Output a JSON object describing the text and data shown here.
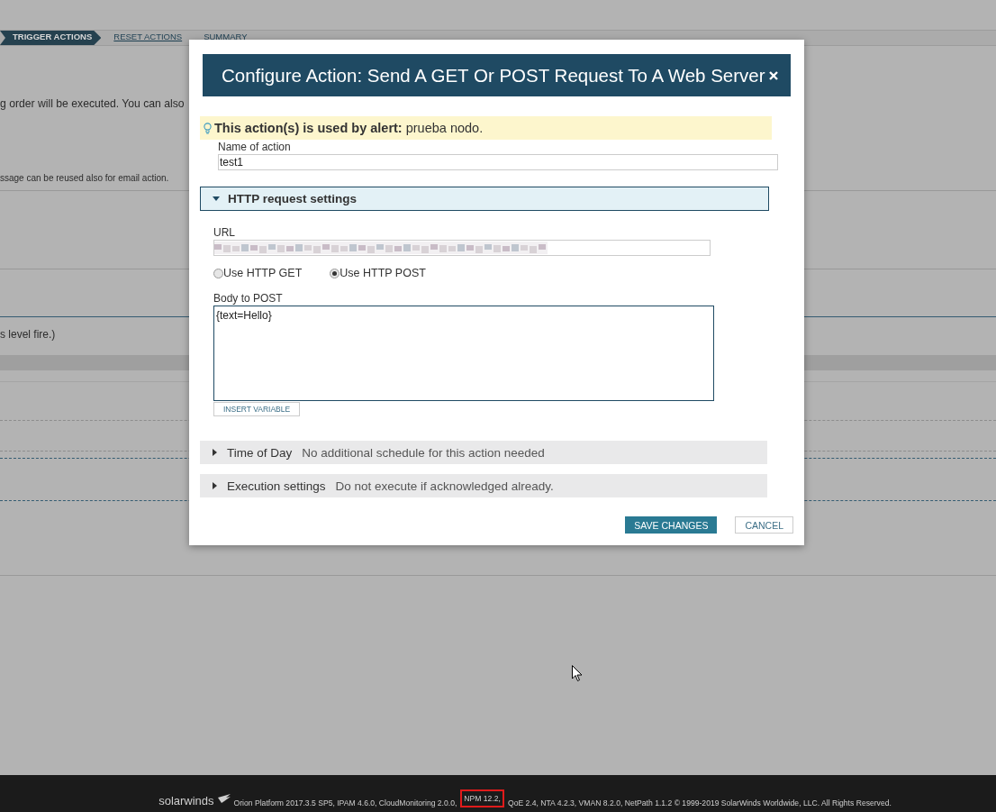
{
  "wizard_steps": [
    {
      "label": "TRIGGER ACTIONS",
      "selected": true
    },
    {
      "label": "RESET ACTIONS",
      "selected": false
    },
    {
      "label": "SUMMARY",
      "selected": false
    }
  ],
  "background_texts": [
    "g order will be executed. You can also",
    "ssage can be reused also for email action.",
    "s level fire.)"
  ],
  "dialog": {
    "title": "Configure Action: Send A GET Or POST Request To A Web Server",
    "notice": {
      "label": "This action(s) is used by alert:",
      "value": "prueba nodo."
    },
    "name_field": {
      "label": "Name of action",
      "value": "test1"
    },
    "http_section": {
      "title": "HTTP request settings",
      "expanded": true,
      "url_label": "URL",
      "methods": [
        {
          "label": "Use HTTP GET",
          "selected": false
        },
        {
          "label": "Use HTTP POST",
          "selected": true
        }
      ],
      "body_label": "Body to POST",
      "body_value": "{text=Hello}",
      "insert_button": "INSERT VARIABLE"
    },
    "collapsed_sections": [
      {
        "title": "Time of Day",
        "summary": "No additional schedule for this action needed",
        "expanded": false
      },
      {
        "title": "Execution settings",
        "summary": "Do not execute if acknowledged already.",
        "expanded": false
      }
    ],
    "save_button": "SAVE CHANGES",
    "cancel_button": "CANCEL"
  },
  "footer": {
    "brand": "solarwinds",
    "versions_before": "Orion Platform 2017.3.5 SP5, IPAM 4.6.0, CloudMonitoring 2.0.0,",
    "highlighted": "NPM 12.2,",
    "versions_after": "QoE 2.4, NTA 4.2.3, VMAN 8.2.0, NetPath 1.1.2 © 1999-2019 SolarWinds Worldwide, LLC. All Rights Reserved."
  }
}
